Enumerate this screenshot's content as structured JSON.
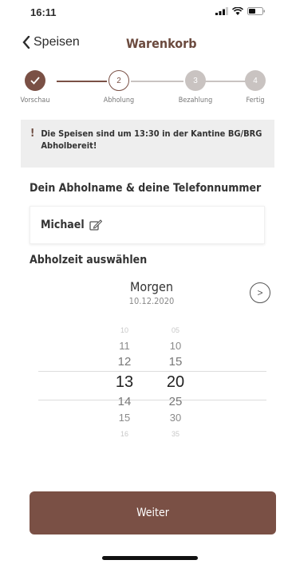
{
  "status_bar": {
    "time": "16:11"
  },
  "nav": {
    "back_label": "Speisen",
    "title": "Warenkorb"
  },
  "steps": [
    {
      "label": "Vorschau",
      "number": "✓",
      "state": "done"
    },
    {
      "label": "Abholung",
      "number": "2",
      "state": "active"
    },
    {
      "label": "Bezahlung",
      "number": "3",
      "state": "todo"
    },
    {
      "label": "Fertig",
      "number": "4",
      "state": "todo"
    }
  ],
  "notice": {
    "icon": "!",
    "text": "Die Speisen sind um 13:30 in der Kantine BG/BRG Abholbereit!"
  },
  "pickup_name": {
    "title": "Dein Abholname & deine Telefonnummer",
    "value": "Michael"
  },
  "pickup_time": {
    "title": "Abholzeit auswählen",
    "day": "Morgen",
    "date": "10.12.2020",
    "next_icon": ">",
    "hours": [
      "10",
      "11",
      "12",
      "13",
      "14",
      "15",
      "16"
    ],
    "minutes": [
      "05",
      "10",
      "15",
      "20",
      "25",
      "30",
      "35"
    ],
    "selected_index": 3
  },
  "footer": {
    "button_label": "Weiter"
  },
  "colors": {
    "accent": "#7a5045",
    "title": "#6b4a3e",
    "inactive": "#c9c3c1"
  }
}
